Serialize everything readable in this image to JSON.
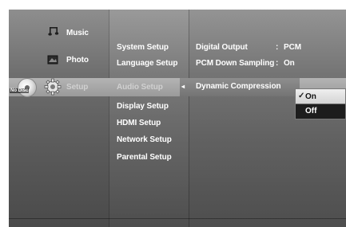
{
  "main_menu": {
    "items": [
      {
        "label": "Music",
        "icon": "music-note-icon"
      },
      {
        "label": "Photo",
        "icon": "photo-icon"
      },
      {
        "label": "Setup",
        "icon": "gear-icon"
      }
    ],
    "disc_status": "No Disc"
  },
  "setup_menu": {
    "items": [
      "System Setup",
      "Language Setup",
      "Audio Setup",
      "Display Setup",
      "HDMI Setup",
      "Network Setup",
      "Parental Setup"
    ],
    "selected": "Audio Setup"
  },
  "audio_settings": [
    {
      "name": "Digital Output",
      "separator": ":",
      "value": "PCM"
    },
    {
      "name": "PCM Down Sampling",
      "separator": ":",
      "value": "On"
    },
    {
      "name": "Dynamic Compression",
      "separator": ":",
      "value": ""
    }
  ],
  "dropdown": {
    "options": [
      {
        "label": "On",
        "check": "✓"
      },
      {
        "label": "Off",
        "check": ""
      }
    ],
    "selected": "On"
  },
  "arrow": "◂",
  "colors": {
    "highlight": "#a8a8a8",
    "dropdown_selected": "#e0e0e0",
    "dropdown_unselected": "#1d1d1d"
  }
}
